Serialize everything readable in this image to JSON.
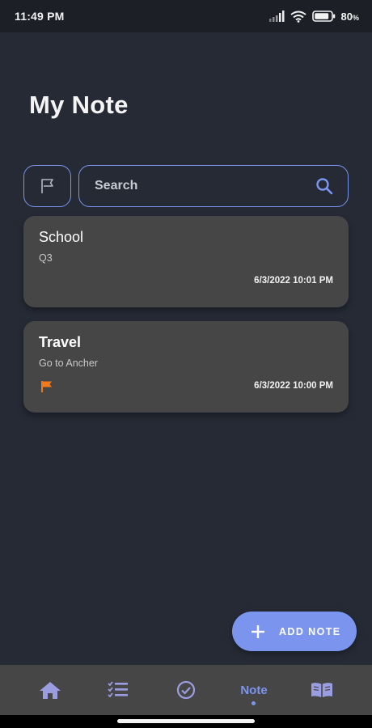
{
  "status_bar": {
    "time": "11:49 PM",
    "battery": "80",
    "battery_unit": "%"
  },
  "header": {
    "title": "My Note"
  },
  "search": {
    "placeholder": "Search",
    "value": ""
  },
  "notes": [
    {
      "title": "School",
      "subtitle": "Q3",
      "date": "6/3/2022 10:01 PM",
      "flagged": false
    },
    {
      "title": "Travel",
      "subtitle": "Go to Ancher",
      "date": "6/3/2022 10:00 PM",
      "flagged": true
    }
  ],
  "fab": {
    "label": "ADD NOTE"
  },
  "bottom_nav": {
    "items": [
      {
        "id": "home",
        "icon": "home-icon"
      },
      {
        "id": "checklist",
        "icon": "checklist-icon"
      },
      {
        "id": "done",
        "icon": "check-circle-icon"
      },
      {
        "id": "note",
        "label": "Note",
        "active": true
      },
      {
        "id": "book",
        "icon": "book-icon"
      }
    ]
  },
  "colors": {
    "background": "#252a35",
    "accent": "#7b95ee",
    "card": "#464646",
    "flag": "#f07a1c",
    "nav_icon": "#9a9ee0"
  }
}
